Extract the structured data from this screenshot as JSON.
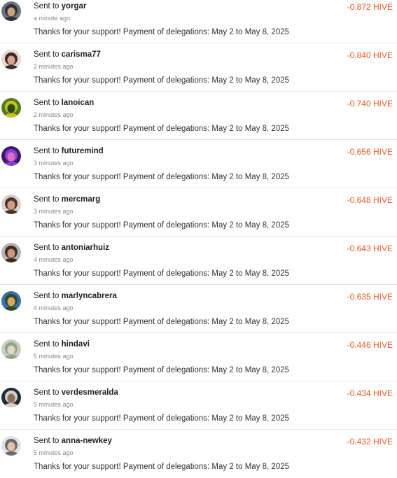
{
  "transfers": [
    {
      "prefix": "Sent to",
      "user": "yorgar",
      "time": "a minute ago",
      "memo": "Thanks for your support! Payment of delegations: May 2 to May 8, 2025",
      "amount": "-0.872 HIVE",
      "avatar_colors": [
        "#6d7480",
        "#2f2f35",
        "#c9a37c"
      ]
    },
    {
      "prefix": "Sent to",
      "user": "carisma77",
      "time": "2 minutes ago",
      "memo": "Thanks for your support! Payment of delegations: May 2 to May 8, 2025",
      "amount": "-0.840 HIVE",
      "avatar_colors": [
        "#e9d7d0",
        "#3a2a25",
        "#d9a58e"
      ]
    },
    {
      "prefix": "Sent to",
      "user": "lanoican",
      "time": "2 minutes ago",
      "memo": "Thanks for your support! Payment of delegations: May 2 to May 8, 2025",
      "amount": "-0.740 HIVE",
      "avatar_colors": [
        "#4f7d1f",
        "#c9c419",
        "#2a4a10"
      ]
    },
    {
      "prefix": "Sent to",
      "user": "futuremind",
      "time": "3 minutes ago",
      "memo": "Thanks for your support! Payment of delegations: May 2 to May 8, 2025",
      "amount": "-0.656 HIVE",
      "avatar_colors": [
        "#3b1a66",
        "#8a3fd1",
        "#e06cc8"
      ]
    },
    {
      "prefix": "Sent to",
      "user": "mercmarg",
      "time": "3 minutes ago",
      "memo": "Thanks for your support! Payment of delegations: May 2 to May 8, 2025",
      "amount": "-0.648 HIVE",
      "avatar_colors": [
        "#d9d2cc",
        "#4a3328",
        "#d39b84"
      ]
    },
    {
      "prefix": "Sent to",
      "user": "antoniarhuiz",
      "time": "4 minutes ago",
      "memo": "Thanks for your support! Payment of delegations: May 2 to May 8, 2025",
      "amount": "-0.643 HIVE",
      "avatar_colors": [
        "#b7b2ad",
        "#3b2a22",
        "#c99679"
      ]
    },
    {
      "prefix": "Sent to",
      "user": "marlyncabrera",
      "time": "4 minutes ago",
      "memo": "Thanks for your support! Payment of delegations: May 2 to May 8, 2025",
      "amount": "-0.635 HIVE",
      "avatar_colors": [
        "#3b6fb0",
        "#2b4d1f",
        "#d9a36a"
      ]
    },
    {
      "prefix": "Sent to",
      "user": "hindavi",
      "time": "5 minutes ago",
      "memo": "Thanks for your support! Payment of delegations: May 2 to May 8, 2025",
      "amount": "-0.446 HIVE",
      "avatar_colors": [
        "#c7cfc4",
        "#8ea483",
        "#e0d8cf"
      ]
    },
    {
      "prefix": "Sent to",
      "user": "verdesmeralda",
      "time": "5 minutes ago",
      "memo": "Thanks for your support! Payment of delegations: May 2 to May 8, 2025",
      "amount": "-0.434 HIVE",
      "avatar_colors": [
        "#1d2b3a",
        "#d8cfc4",
        "#8a6e58"
      ]
    },
    {
      "prefix": "Sent to",
      "user": "anna-newkey",
      "time": "5 minutes ago",
      "memo": "Thanks for your support! Payment of delegations: May 2 to May 8, 2025",
      "amount": "-0.432 HIVE",
      "avatar_colors": [
        "#dfe3e8",
        "#6a6a6a",
        "#e2c2a8"
      ]
    }
  ]
}
